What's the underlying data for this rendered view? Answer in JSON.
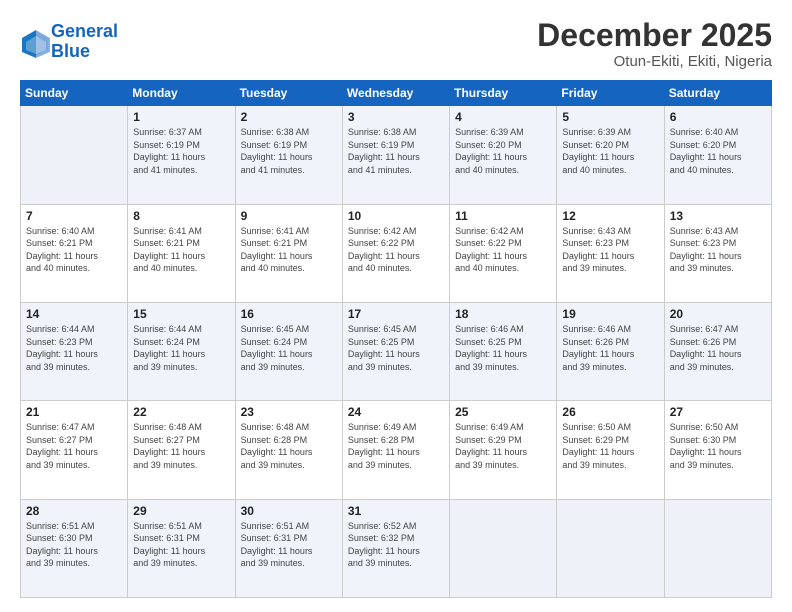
{
  "header": {
    "logo_line1": "General",
    "logo_line2": "Blue",
    "month": "December 2025",
    "location": "Otun-Ekiti, Ekiti, Nigeria"
  },
  "weekdays": [
    "Sunday",
    "Monday",
    "Tuesday",
    "Wednesday",
    "Thursday",
    "Friday",
    "Saturday"
  ],
  "weeks": [
    [
      {
        "day": "",
        "info": ""
      },
      {
        "day": "1",
        "info": "Sunrise: 6:37 AM\nSunset: 6:19 PM\nDaylight: 11 hours\nand 41 minutes."
      },
      {
        "day": "2",
        "info": "Sunrise: 6:38 AM\nSunset: 6:19 PM\nDaylight: 11 hours\nand 41 minutes."
      },
      {
        "day": "3",
        "info": "Sunrise: 6:38 AM\nSunset: 6:19 PM\nDaylight: 11 hours\nand 41 minutes."
      },
      {
        "day": "4",
        "info": "Sunrise: 6:39 AM\nSunset: 6:20 PM\nDaylight: 11 hours\nand 40 minutes."
      },
      {
        "day": "5",
        "info": "Sunrise: 6:39 AM\nSunset: 6:20 PM\nDaylight: 11 hours\nand 40 minutes."
      },
      {
        "day": "6",
        "info": "Sunrise: 6:40 AM\nSunset: 6:20 PM\nDaylight: 11 hours\nand 40 minutes."
      }
    ],
    [
      {
        "day": "7",
        "info": "Sunrise: 6:40 AM\nSunset: 6:21 PM\nDaylight: 11 hours\nand 40 minutes."
      },
      {
        "day": "8",
        "info": "Sunrise: 6:41 AM\nSunset: 6:21 PM\nDaylight: 11 hours\nand 40 minutes."
      },
      {
        "day": "9",
        "info": "Sunrise: 6:41 AM\nSunset: 6:21 PM\nDaylight: 11 hours\nand 40 minutes."
      },
      {
        "day": "10",
        "info": "Sunrise: 6:42 AM\nSunset: 6:22 PM\nDaylight: 11 hours\nand 40 minutes."
      },
      {
        "day": "11",
        "info": "Sunrise: 6:42 AM\nSunset: 6:22 PM\nDaylight: 11 hours\nand 40 minutes."
      },
      {
        "day": "12",
        "info": "Sunrise: 6:43 AM\nSunset: 6:23 PM\nDaylight: 11 hours\nand 39 minutes."
      },
      {
        "day": "13",
        "info": "Sunrise: 6:43 AM\nSunset: 6:23 PM\nDaylight: 11 hours\nand 39 minutes."
      }
    ],
    [
      {
        "day": "14",
        "info": "Sunrise: 6:44 AM\nSunset: 6:23 PM\nDaylight: 11 hours\nand 39 minutes."
      },
      {
        "day": "15",
        "info": "Sunrise: 6:44 AM\nSunset: 6:24 PM\nDaylight: 11 hours\nand 39 minutes."
      },
      {
        "day": "16",
        "info": "Sunrise: 6:45 AM\nSunset: 6:24 PM\nDaylight: 11 hours\nand 39 minutes."
      },
      {
        "day": "17",
        "info": "Sunrise: 6:45 AM\nSunset: 6:25 PM\nDaylight: 11 hours\nand 39 minutes."
      },
      {
        "day": "18",
        "info": "Sunrise: 6:46 AM\nSunset: 6:25 PM\nDaylight: 11 hours\nand 39 minutes."
      },
      {
        "day": "19",
        "info": "Sunrise: 6:46 AM\nSunset: 6:26 PM\nDaylight: 11 hours\nand 39 minutes."
      },
      {
        "day": "20",
        "info": "Sunrise: 6:47 AM\nSunset: 6:26 PM\nDaylight: 11 hours\nand 39 minutes."
      }
    ],
    [
      {
        "day": "21",
        "info": "Sunrise: 6:47 AM\nSunset: 6:27 PM\nDaylight: 11 hours\nand 39 minutes."
      },
      {
        "day": "22",
        "info": "Sunrise: 6:48 AM\nSunset: 6:27 PM\nDaylight: 11 hours\nand 39 minutes."
      },
      {
        "day": "23",
        "info": "Sunrise: 6:48 AM\nSunset: 6:28 PM\nDaylight: 11 hours\nand 39 minutes."
      },
      {
        "day": "24",
        "info": "Sunrise: 6:49 AM\nSunset: 6:28 PM\nDaylight: 11 hours\nand 39 minutes."
      },
      {
        "day": "25",
        "info": "Sunrise: 6:49 AM\nSunset: 6:29 PM\nDaylight: 11 hours\nand 39 minutes."
      },
      {
        "day": "26",
        "info": "Sunrise: 6:50 AM\nSunset: 6:29 PM\nDaylight: 11 hours\nand 39 minutes."
      },
      {
        "day": "27",
        "info": "Sunrise: 6:50 AM\nSunset: 6:30 PM\nDaylight: 11 hours\nand 39 minutes."
      }
    ],
    [
      {
        "day": "28",
        "info": "Sunrise: 6:51 AM\nSunset: 6:30 PM\nDaylight: 11 hours\nand 39 minutes."
      },
      {
        "day": "29",
        "info": "Sunrise: 6:51 AM\nSunset: 6:31 PM\nDaylight: 11 hours\nand 39 minutes."
      },
      {
        "day": "30",
        "info": "Sunrise: 6:51 AM\nSunset: 6:31 PM\nDaylight: 11 hours\nand 39 minutes."
      },
      {
        "day": "31",
        "info": "Sunrise: 6:52 AM\nSunset: 6:32 PM\nDaylight: 11 hours\nand 39 minutes."
      },
      {
        "day": "",
        "info": ""
      },
      {
        "day": "",
        "info": ""
      },
      {
        "day": "",
        "info": ""
      }
    ]
  ]
}
